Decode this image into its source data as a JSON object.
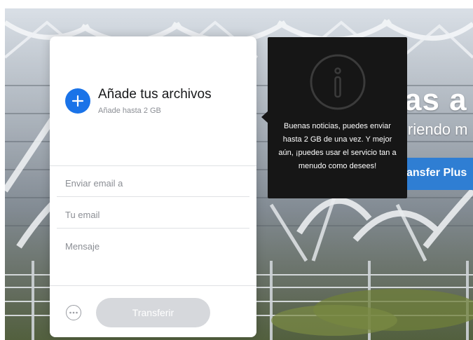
{
  "background": {
    "headline": "as a t",
    "subline": "iriendo m",
    "plus_button": "ansfer Plus"
  },
  "upload": {
    "title": "Añade tus archivos",
    "subtitle": "Añade hasta 2 GB",
    "fields": {
      "to_placeholder": "Enviar email a",
      "from_placeholder": "Tu email",
      "message_placeholder": "Mensaje"
    },
    "transfer_label": "Transferir"
  },
  "tooltip": {
    "text": "Buenas noticias, puedes enviar hasta 2 GB de una vez. Y mejor aún, ¡puedes usar el servicio tan a menudo como desees!"
  },
  "colors": {
    "accent": "#1a73e8",
    "disabled_button": "#d6d8dc",
    "tooltip_bg": "#161616"
  },
  "icons": {
    "add": "plus-icon",
    "more": "more-options-icon",
    "info": "info-icon"
  }
}
